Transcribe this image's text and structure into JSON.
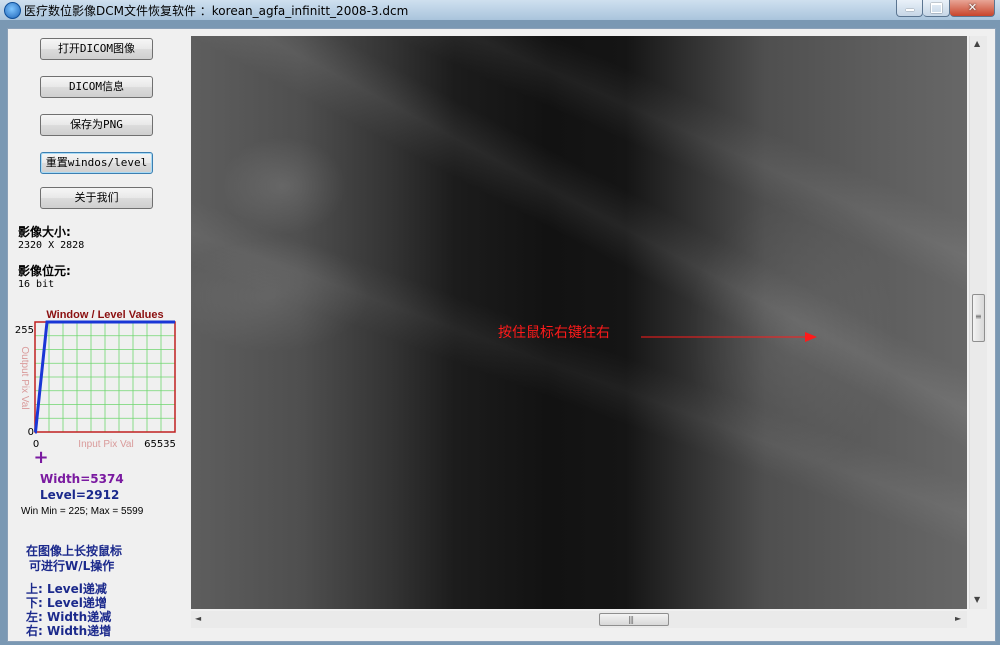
{
  "window": {
    "title": "医疗数位影像DCM文件恢复软件 ：korean_agfa_infinitt_2008-3.dcm",
    "close_glyph": "✕"
  },
  "toolbar": {
    "open_dicom": "打开DICOM图像",
    "dicom_info": "DICOM信息",
    "save_png": "保存为PNG",
    "reset_wl": "重置windos/level",
    "about": "关于我们"
  },
  "image_info": {
    "size_label": "影像大小:",
    "size_value": "2320 X 2828",
    "bits_label": "影像位元:",
    "bits_value": "16 bit"
  },
  "wl_chart": {
    "title": "Window / Level Values",
    "ylabel": "Output Pix Val",
    "xlabel": "Input Pix Val",
    "y_max_label": "255",
    "y_min_label": "0",
    "x_min_label": "0",
    "x_max_label": "65535",
    "marker_glyph": "+",
    "width_text": "Width=5374",
    "level_text": "Level=2912",
    "minmax_text": "Win Min = 225; Max = 5599"
  },
  "chart_data": {
    "type": "line",
    "title": "Window / Level Values",
    "xlabel": "Input Pix Val",
    "ylabel": "Output Pix Val",
    "xlim": [
      0,
      65535
    ],
    "ylim": [
      0,
      255
    ],
    "grid": true,
    "series": [
      {
        "x": [
          0,
          225,
          5599,
          65535
        ],
        "y": [
          0,
          0,
          255,
          255
        ]
      }
    ],
    "colors": {
      "line": "#1a36d6",
      "grid": "#6fd66f",
      "frame": "#c02020",
      "marker": "#7a1aa0"
    }
  },
  "instructions": {
    "line1": "在图像上长按鼠标",
    "line2": "可进行W/L操作",
    "up": "上: Level递减",
    "down": "下: Level递增",
    "left": "左: Width递减",
    "right": "右: Width递增"
  },
  "viewer": {
    "overlay_text": "按住鼠标右键往右",
    "overlay_color": "#ff1a1a"
  },
  "scrollbars": {
    "up_arrow": "▲",
    "down_arrow": "▼",
    "left_arrow": "◄",
    "right_arrow": "►",
    "v_grip": "≡",
    "h_grip": "|||"
  }
}
